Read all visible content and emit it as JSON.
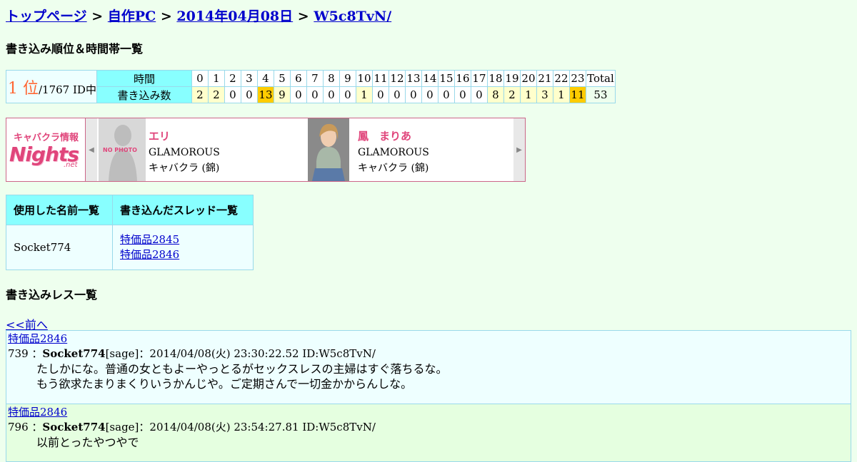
{
  "breadcrumb": {
    "items": [
      "トップページ",
      "自作PC",
      "2014年04月08日",
      "W5c8TvN/"
    ],
    "separator": ">"
  },
  "ranking_section": {
    "title": "書き込み順位＆時間帯一覧",
    "rank_number": "1 位",
    "rank_total": "/1767 ID中",
    "time_label": "時間",
    "count_label": "書き込み数",
    "total_label": "Total",
    "hours": [
      "0",
      "1",
      "2",
      "3",
      "4",
      "5",
      "6",
      "7",
      "8",
      "9",
      "10",
      "11",
      "12",
      "13",
      "14",
      "15",
      "16",
      "17",
      "18",
      "19",
      "20",
      "21",
      "22",
      "23"
    ],
    "counts": [
      "2",
      "2",
      "0",
      "0",
      "13",
      "9",
      "0",
      "0",
      "0",
      "0",
      "1",
      "0",
      "0",
      "0",
      "0",
      "0",
      "0",
      "0",
      "8",
      "2",
      "1",
      "3",
      "1",
      "11"
    ],
    "total": "53",
    "colors": {
      "header": "#88ffff",
      "low": "#ffffcc",
      "high": "#ffcc00",
      "total": "#ff8844"
    }
  },
  "ad": {
    "logo_line1": "キャバクラ情報",
    "logo_line2": "Nights",
    "logo_line3": ".net",
    "cards": [
      {
        "name": "エリ",
        "shop": "GLAMOROUS",
        "kind": "キャバクラ (錦)",
        "photo_text": "NO PHOTO"
      },
      {
        "name": "鳳　まりあ",
        "shop": "GLAMOROUS",
        "kind": "キャバクラ (錦)",
        "photo_text": ""
      }
    ]
  },
  "names_table": {
    "col1": "使用した名前一覧",
    "col2": "書き込んだスレッド一覧",
    "name": "Socket774",
    "threads": [
      "特価品2845",
      "特価品2846"
    ]
  },
  "responses_section": {
    "title": "書き込みレス一覧",
    "prev_link": "<<前へ",
    "posts": [
      {
        "thread": "特価品2846",
        "number": "739",
        "author": "Socket774",
        "meta": "[sage]：2014/04/08(火) 23:30:22.52 ID:W5c8TvN/",
        "lines": [
          "たしかにな。普通の女ともよーやっとるがセックスレスの主婦はすぐ落ちるな。",
          "もう欲求たまりまくりいうかんじや。ご定期さんで一切金かからんしな。"
        ]
      },
      {
        "thread": "特価品2846",
        "number": "796",
        "author": "Socket774",
        "meta": "[sage]：2014/04/08(火) 23:54:27.81 ID:W5c8TvN/",
        "lines": [
          "以前とったやつやで"
        ]
      }
    ]
  }
}
